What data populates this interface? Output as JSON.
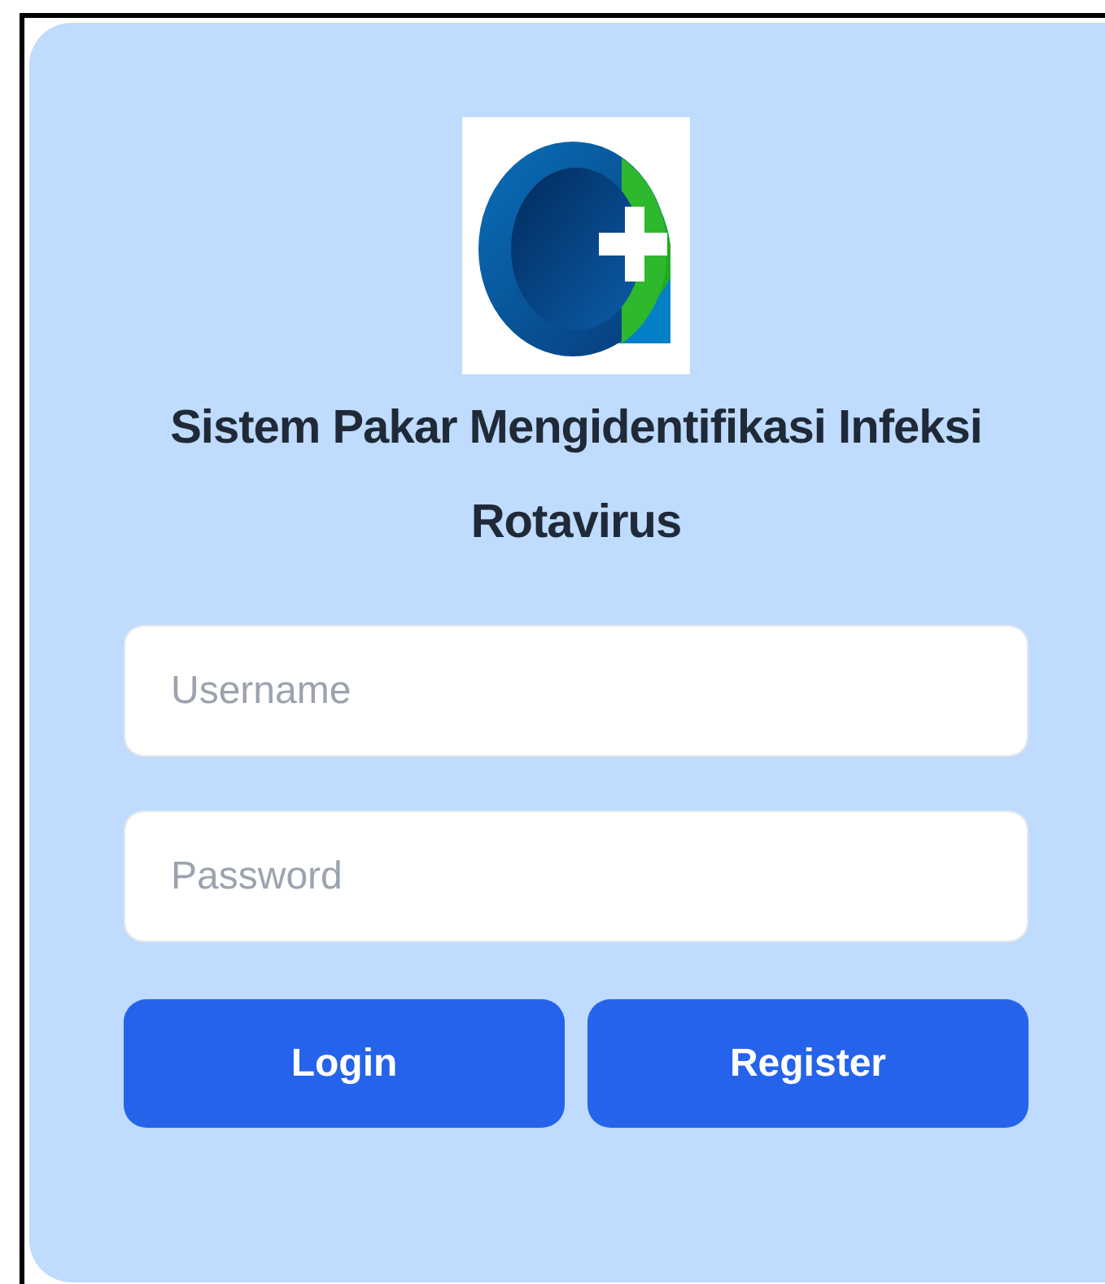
{
  "title": "Sistem Pakar Mengidentifikasi Infeksi Rotavirus",
  "fields": [
    {
      "placeholder": "Username"
    },
    {
      "placeholder": "Password"
    }
  ],
  "buttons": [
    {
      "label": "Login"
    },
    {
      "label": "Register"
    }
  ]
}
